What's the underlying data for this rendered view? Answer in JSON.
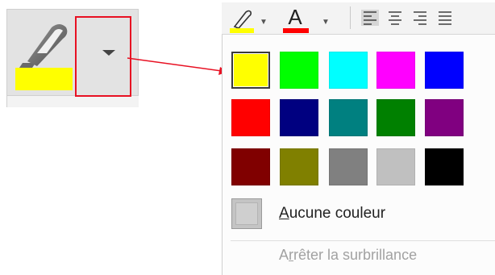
{
  "zoomed_button": {
    "icon": "highlighter-pen-icon",
    "color_bar": "#ffff00",
    "dropdown_icon": "chevron-down-icon",
    "callout_color": "#e81123"
  },
  "ribbon": {
    "highlight_color_button": {
      "icon": "highlighter-pen-icon",
      "color": "#ffff00"
    },
    "font_color_button": {
      "letter": "A",
      "color": "#ff0000"
    },
    "alignment_buttons": [
      "align-left-icon",
      "align-center-icon",
      "align-right-icon",
      "justify-icon"
    ]
  },
  "palette": {
    "colors": [
      [
        "#ffff00",
        "#00ff00",
        "#00ffff",
        "#ff00ff",
        "#0000ff"
      ],
      [
        "#ff0000",
        "#000080",
        "#008080",
        "#008000",
        "#800080"
      ],
      [
        "#800000",
        "#808000",
        "#808080",
        "#c0c0c0",
        "#000000"
      ]
    ],
    "selected": "#ffff00",
    "no_color_prefix": "",
    "no_color_mnemonic": "A",
    "no_color_rest": "ucune couleur",
    "stop_prefix": "A",
    "stop_mnemonic": "r",
    "stop_rest": "rêter la surbrillance"
  }
}
